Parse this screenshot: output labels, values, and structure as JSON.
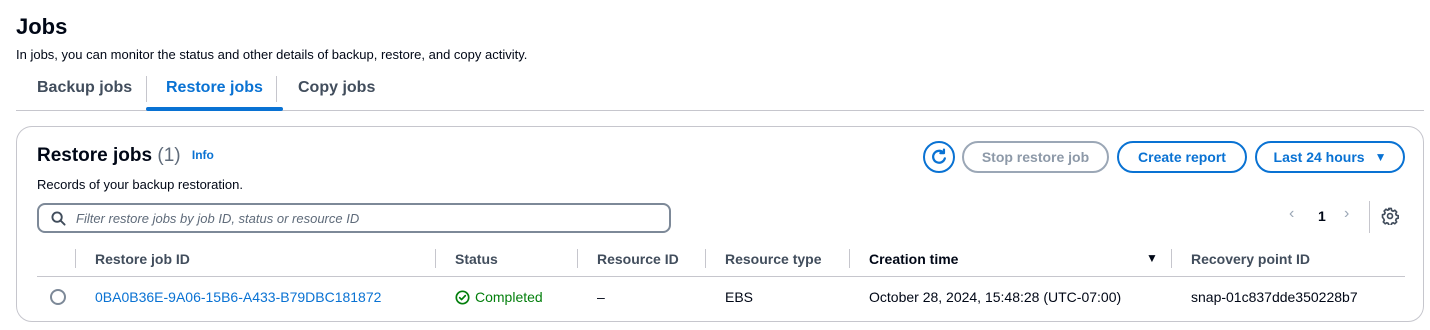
{
  "page": {
    "title": "Jobs",
    "description": "In jobs, you can monitor the status and other details of backup, restore, and copy activity."
  },
  "tabs": [
    {
      "label": "Backup jobs",
      "active": false
    },
    {
      "label": "Restore jobs",
      "active": true
    },
    {
      "label": "Copy jobs",
      "active": false
    }
  ],
  "panel": {
    "title": "Restore jobs",
    "count": "(1)",
    "info_label": "Info",
    "description": "Records of your backup restoration."
  },
  "actions": {
    "refresh_icon": "refresh-icon",
    "stop_label": "Stop restore job",
    "report_label": "Create report",
    "range_label": "Last 24 hours"
  },
  "filter": {
    "placeholder": "Filter restore jobs by job ID, status or resource ID",
    "value": ""
  },
  "pagination": {
    "current_page": "1",
    "prev": "‹",
    "next": "›"
  },
  "table": {
    "columns": [
      "Restore job ID",
      "Status",
      "Resource ID",
      "Resource type",
      "Creation time",
      "Recovery point ID"
    ],
    "sorted_column": "Creation time",
    "sort_direction": "descending",
    "rows": [
      {
        "job_id": "0BA0B36E-9A06-15B6-A433-B79DBC181872",
        "status": "Completed",
        "resource_id": "–",
        "resource_type": "EBS",
        "creation_time": "October 28, 2024, 15:48:28 (UTC-07:00)",
        "recovery_point_id": "snap-01c837dde350228b7"
      }
    ]
  },
  "colors": {
    "accent": "#0972d3",
    "success": "#037f0c",
    "text": "#000716",
    "disabled": "#8d99a8",
    "border": "#c6c6cd"
  }
}
